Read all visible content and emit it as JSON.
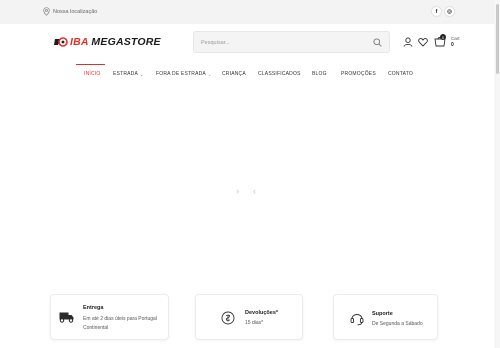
{
  "topbar": {
    "location_label": "Nossa localização",
    "facebook_label": "f",
    "instagram_label": "◎"
  },
  "header": {
    "logo_part1": "IBA",
    "logo_part2": "MEGASTORE",
    "search_placeholder": "Pesquisar...",
    "cart_label": "Cart",
    "cart_total": "0",
    "cart_count": "0"
  },
  "nav": {
    "items": [
      {
        "label": "INÍCIO"
      },
      {
        "label": "ESTRADA"
      },
      {
        "label": "FORA DE ESTRADA"
      },
      {
        "label": "CRIANÇA"
      },
      {
        "label": "CLASSIFICADOS"
      },
      {
        "label": "BLOG"
      },
      {
        "label": "PROMOÇÕES"
      },
      {
        "label": "CONTATO"
      }
    ]
  },
  "slider": {
    "prev": "›",
    "next": "‹"
  },
  "features": [
    {
      "title": "Entrega",
      "desc_line1": "Em até 2 dias úteis para Portugal",
      "desc_line2": "Continental",
      "icon": "truck-icon"
    },
    {
      "title": "Devoluções*",
      "desc_line1": "15 dias*",
      "icon": "coin-icon"
    },
    {
      "title": "Suporte",
      "desc_line1": "De Segunda a Sábado",
      "icon": "headset-icon"
    }
  ],
  "colors": {
    "accent": "#e0302a",
    "topbar_bg": "#f3f3f3"
  }
}
